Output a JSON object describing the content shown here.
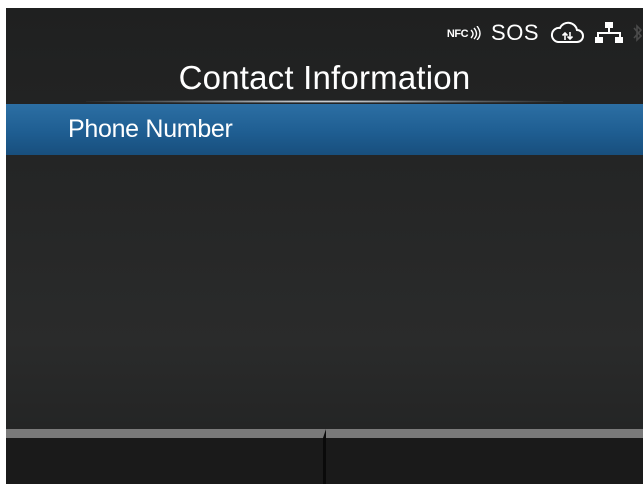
{
  "status_bar": {
    "nfc_label": "NFC",
    "sos_label": "SOS",
    "icons": [
      "nfc-icon",
      "sos-indicator",
      "cloud-sync-icon",
      "network-icon",
      "bluetooth-icon"
    ]
  },
  "screen": {
    "title": "Contact Information"
  },
  "menu": {
    "items": [
      {
        "label": "Phone Number",
        "selected": true
      }
    ]
  },
  "softkeys": [
    {
      "label": ""
    },
    {
      "label": ""
    }
  ],
  "colors": {
    "background": "#262727",
    "selection": "#1f5e92",
    "text": "#ffffff",
    "softkey_border": "#7a7a7a"
  }
}
